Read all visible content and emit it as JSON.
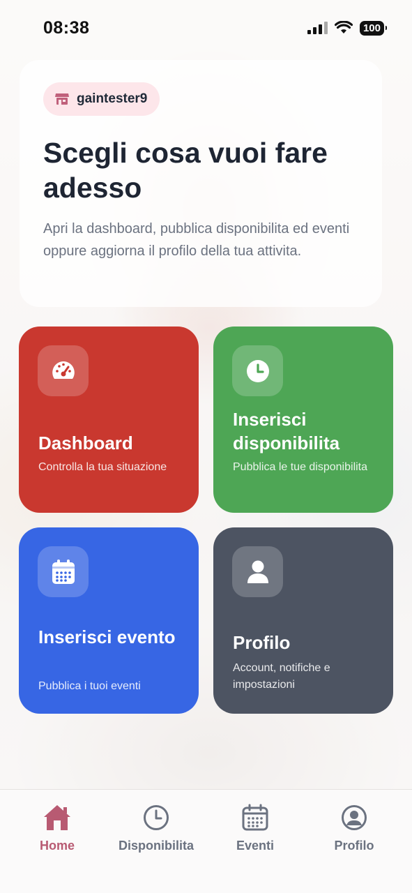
{
  "status_bar": {
    "time": "08:38",
    "battery": "100"
  },
  "hero": {
    "username": "gaintester9",
    "title": "Scegli cosa vuoi fare adesso",
    "subtitle": "Apri la dashboard, pubblica disponibilita ed eventi oppure aggiorna il profilo della tua attivita."
  },
  "tiles": [
    {
      "title": "Dashboard",
      "subtitle": "Controlla la tua situazione",
      "icon": "speedometer-icon",
      "color": "#c9382f"
    },
    {
      "title": "Inserisci disponibilita",
      "subtitle": "Pubblica le tue disponibilita",
      "icon": "clock-icon",
      "color": "#4ea655"
    },
    {
      "title": "Inserisci evento",
      "subtitle": "Pubblica i tuoi eventi",
      "icon": "calendar-icon",
      "color": "#3766e4"
    },
    {
      "title": "Profilo",
      "subtitle": "Account, notifiche e impostazioni",
      "icon": "user-icon",
      "color": "#4d5462"
    }
  ],
  "tabbar": {
    "items": [
      {
        "label": "Home",
        "icon": "home-icon",
        "active": true
      },
      {
        "label": "Disponibilita",
        "icon": "clock-icon",
        "active": false
      },
      {
        "label": "Eventi",
        "icon": "calendar-icon",
        "active": false
      },
      {
        "label": "Profilo",
        "icon": "user-circle-icon",
        "active": false
      }
    ],
    "active_color": "#b85a72",
    "inactive_color": "#6b7280"
  }
}
